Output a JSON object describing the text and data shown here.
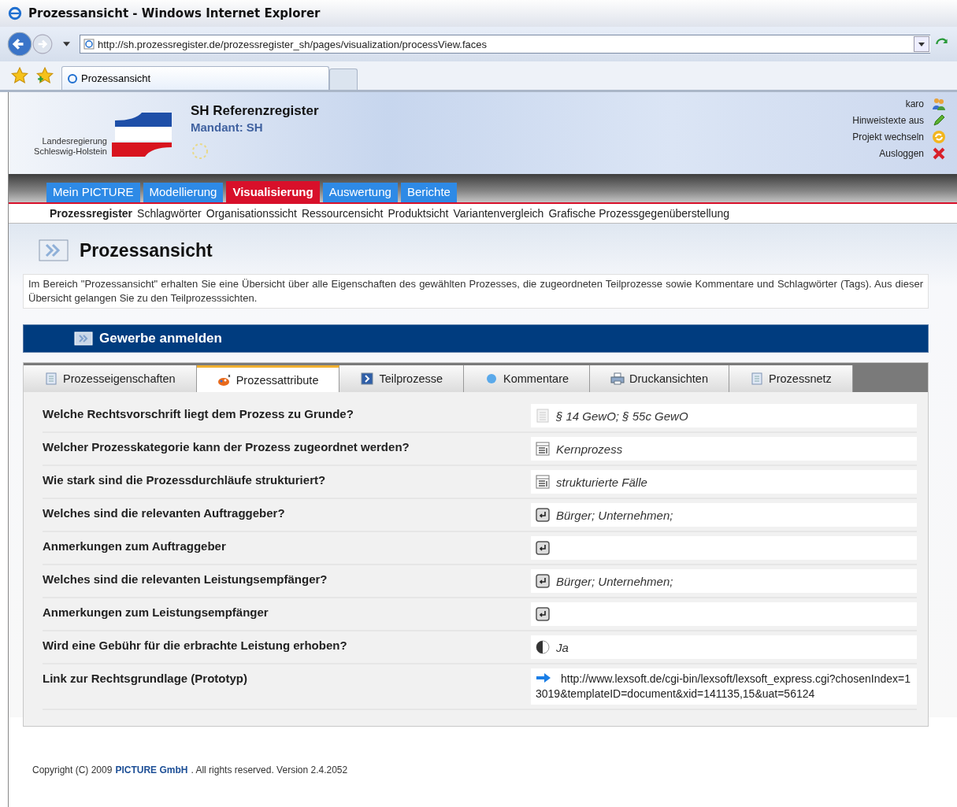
{
  "window": {
    "title": "Prozessansicht - Windows Internet Explorer"
  },
  "address_bar": {
    "value": "http://sh.prozessregister.de/prozessregister_sh/pages/visualization/processView.faces"
  },
  "browser_tabs": [
    {
      "label": "Prozessansicht",
      "selected": true
    }
  ],
  "header": {
    "org_line1": "Landesregierung",
    "org_line2": "Schleswig-Holstein",
    "title": "SH Referenzregister",
    "mandant": "Mandant: SH",
    "links": [
      {
        "label": "karo",
        "kind": "user"
      },
      {
        "label": "Hinweistexte aus",
        "kind": "pencil"
      },
      {
        "label": "Projekt wechseln",
        "kind": "switch"
      },
      {
        "label": "Ausloggen",
        "kind": "logout"
      }
    ]
  },
  "main_menu": [
    {
      "label": "Mein PICTURE",
      "selected": false
    },
    {
      "label": "Modellierung",
      "selected": false
    },
    {
      "label": "Visualisierung",
      "selected": true
    },
    {
      "label": "Auswertung",
      "selected": false
    },
    {
      "label": "Berichte",
      "selected": false
    }
  ],
  "sub_menu": [
    {
      "label": "Prozessregister",
      "selected": true
    },
    {
      "label": "Schlagwörter",
      "selected": false
    },
    {
      "label": "Organisationssicht",
      "selected": false
    },
    {
      "label": "Ressourcensicht",
      "selected": false
    },
    {
      "label": "Produktsicht",
      "selected": false
    },
    {
      "label": "Variantenvergleich",
      "selected": false
    },
    {
      "label": "Grafische Prozessgegenüberstellung",
      "selected": false
    }
  ],
  "page_title": "Prozessansicht",
  "description": "Im Bereich \"Prozessansicht\" erhalten Sie eine Übersicht über alle Eigenschaften des gewählten Prozesses, die zugeordneten Teilprozesse sowie Kommentare und Schlagwörter (Tags). Aus dieser Übersicht gelangen Sie zu den Teilprozesssichten.",
  "process_title": "Gewerbe anmelden",
  "tabs": [
    {
      "label": "Prozesseigenschaften",
      "kind": "doc",
      "selected": false
    },
    {
      "label": "Prozessattribute",
      "kind": "palette",
      "selected": true
    },
    {
      "label": "Teilprozesse",
      "kind": "sub",
      "selected": false
    },
    {
      "label": "Kommentare",
      "kind": "bubble",
      "selected": false
    },
    {
      "label": "Druckansichten",
      "kind": "printer",
      "selected": false
    },
    {
      "label": "Prozessnetz",
      "kind": "doc",
      "selected": false
    }
  ],
  "attributes": [
    {
      "question": "Welche Rechtsvorschrift liegt dem Prozess zu Grunde?",
      "kind": "text",
      "answer": "§ 14 GewO; § 55c GewO"
    },
    {
      "question": "Welcher Prozesskategorie kann der Prozess zugeordnet werden?",
      "kind": "list",
      "answer": "Kernprozess"
    },
    {
      "question": "Wie stark sind die Prozessdurchläufe strukturiert?",
      "kind": "list",
      "answer": "strukturierte Fälle"
    },
    {
      "question": "Welches sind die relevanten Auftraggeber?",
      "kind": "entry",
      "answer": "Bürger; Unternehmen;"
    },
    {
      "question": "Anmerkungen zum Auftraggeber",
      "kind": "entry"
    },
    {
      "question": "Welches sind die relevanten Leistungsempfänger?",
      "kind": "entry",
      "answer": "Bürger; Unternehmen;"
    },
    {
      "question": "Anmerkungen zum Leistungsempfänger",
      "kind": "entry"
    },
    {
      "question": "Wird eine Gebühr für die erbrachte Leistung erhoben?",
      "kind": "boolean",
      "answer": "Ja"
    },
    {
      "question": "Link zur Rechtsgrundlage (Prototyp)",
      "kind": "link",
      "answer": "http://www.lexsoft.de/cgi-bin/lexsoft/lexsoft_express.cgi?chosenIndex=13019&templateID=document&xid=141135,15&uat=56124"
    }
  ],
  "footer": {
    "prefix": "Copyright (C) 2009",
    "company": "PICTURE GmbH",
    "suffix": ". All rights reserved. Version 2.4.2052"
  }
}
